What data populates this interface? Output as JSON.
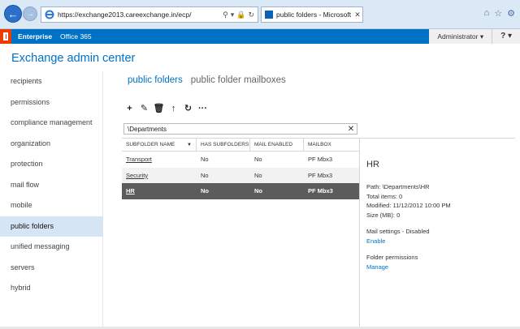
{
  "browser": {
    "url": "https://exchange2013.careexchange.in/ecp/",
    "tab_label": "public folders - Microsoft E...",
    "back_icon": "back-arrow-icon",
    "forward_icon": "forward-arrow-icon"
  },
  "o365bar": {
    "links": [
      "Enterprise",
      "Office 365"
    ],
    "user": "Administrator ▾",
    "help": "? ▾",
    "accent": "#0072c6"
  },
  "app": {
    "title": "Exchange admin center"
  },
  "nav": {
    "items": [
      "recipients",
      "permissions",
      "compliance management",
      "organization",
      "protection",
      "mail flow",
      "mobile",
      "public folders",
      "unified messaging",
      "servers",
      "hybrid"
    ],
    "selected": "public folders"
  },
  "tabs": [
    "public folders",
    "public folder mailboxes"
  ],
  "toolbar": {
    "add": "+",
    "edit": "✎",
    "delete": "🗑",
    "up": "↑",
    "refresh": "↻",
    "more": "···"
  },
  "search": {
    "value": "\\Departments",
    "clear": "✕"
  },
  "grid": {
    "headers": [
      "SUBFOLDER NAME",
      "HAS SUBFOLDERS",
      "MAIL ENABLED",
      "MAILBOX"
    ],
    "sort_arrow": "▼",
    "rows": [
      [
        "Transport",
        "No",
        "No",
        "PF Mbx3"
      ],
      [
        "Security",
        "No",
        "No",
        "PF Mbx3"
      ],
      [
        "HR",
        "No",
        "No",
        "PF Mbx3"
      ]
    ],
    "selected_row": 2
  },
  "details": {
    "title": "HR",
    "path": "Path: \\Departments\\HR",
    "total_items": "Total items: 0",
    "modified": "Modified: 11/12/2012 10:00 PM",
    "size": "Size (MB): 0",
    "mail_settings": "Mail settings - Disabled",
    "enable_link": "Enable",
    "folder_permissions": "Folder permissions",
    "manage_link": "Manage"
  }
}
